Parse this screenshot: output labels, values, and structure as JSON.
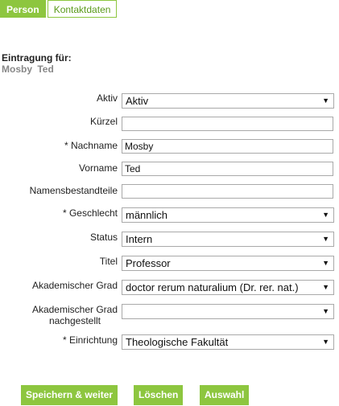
{
  "tabs": {
    "person": "Person",
    "kontaktdaten": "Kontaktdaten"
  },
  "entry": {
    "label": "Eintragung für:",
    "name": "Mosby  Ted"
  },
  "form": {
    "aktiv": {
      "label": "Aktiv",
      "value": "Aktiv"
    },
    "kuerzel": {
      "label": "Kürzel",
      "value": ""
    },
    "nachname": {
      "label": "* Nachname",
      "value": "Mosby"
    },
    "vorname": {
      "label": "Vorname",
      "value": "Ted"
    },
    "namensbestandteile": {
      "label": "Namensbestandteile",
      "value": ""
    },
    "geschlecht": {
      "label": "* Geschlecht",
      "value": "männlich"
    },
    "status": {
      "label": "Status",
      "value": "Intern"
    },
    "titel": {
      "label": "Titel",
      "value": "Professor"
    },
    "akad_grad": {
      "label": "Akademischer Grad",
      "value": "doctor rerum naturalium (Dr. rer. nat.)"
    },
    "akad_grad_nach": {
      "label_line1": "Akademischer Grad",
      "label_line2": "nachgestellt",
      "value": ""
    },
    "einrichtung": {
      "label": "* Einrichtung",
      "value": "Theologische Fakultät"
    }
  },
  "buttons": {
    "save": "Speichern & weiter",
    "delete": "Löschen",
    "select": "Auswahl"
  },
  "icons": {
    "dropdown": "▼"
  },
  "colors": {
    "accent": "#8dc63f",
    "tab_text": "#5a9a1a"
  }
}
